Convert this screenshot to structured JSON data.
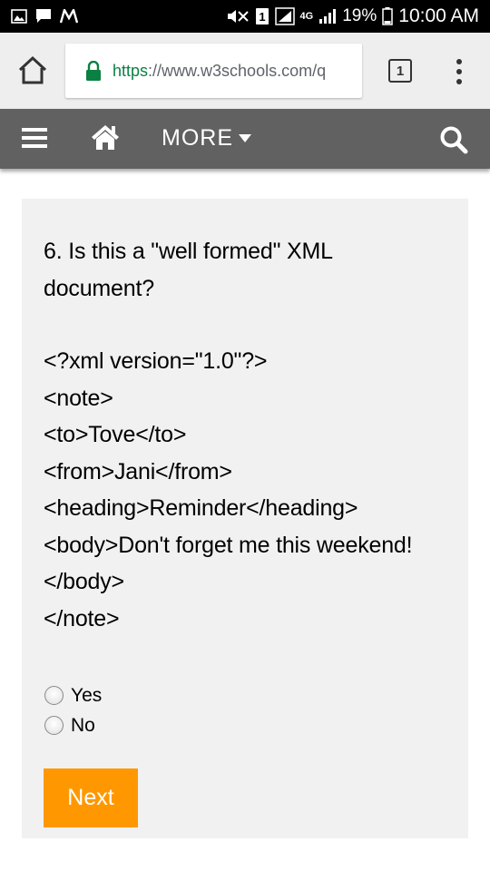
{
  "status_bar": {
    "battery_percent": "19%",
    "time": "10:00 AM",
    "network": "4G",
    "notification_icons": [
      "image-icon",
      "message-icon",
      "m-app-icon"
    ],
    "system_icons": [
      "mute-icon",
      "sim-1-icon",
      "signal-1-icon",
      "signal-2-icon",
      "battery-icon"
    ]
  },
  "browser": {
    "url_scheme": "https",
    "url_rest": "://www.w3schools.com/q",
    "tab_count": "1",
    "icons": [
      "home-icon",
      "lock-icon",
      "tabs-icon",
      "overflow-menu-icon"
    ]
  },
  "nav": {
    "more_label": "MORE",
    "icons": [
      "hamburger-icon",
      "house-icon",
      "caret-down-icon",
      "search-icon"
    ]
  },
  "quiz": {
    "question_lines": [
      "6. Is this a \"well formed\" XML",
      "document?",
      "",
      "<?xml version=\"1.0\"?>",
      "<note>",
      "<to>Tove</to>",
      "<from>Jani</from>",
      "<heading>Reminder</heading>",
      "<body>Don't forget me this weekend!",
      "</body>",
      "</note>"
    ],
    "options": [
      "Yes",
      "No"
    ],
    "next_label": "Next"
  },
  "colors": {
    "nav_bg": "#616161",
    "card_bg": "#f1f1f1",
    "next_button": "#ff9800",
    "url_scheme": "#0b8043"
  }
}
